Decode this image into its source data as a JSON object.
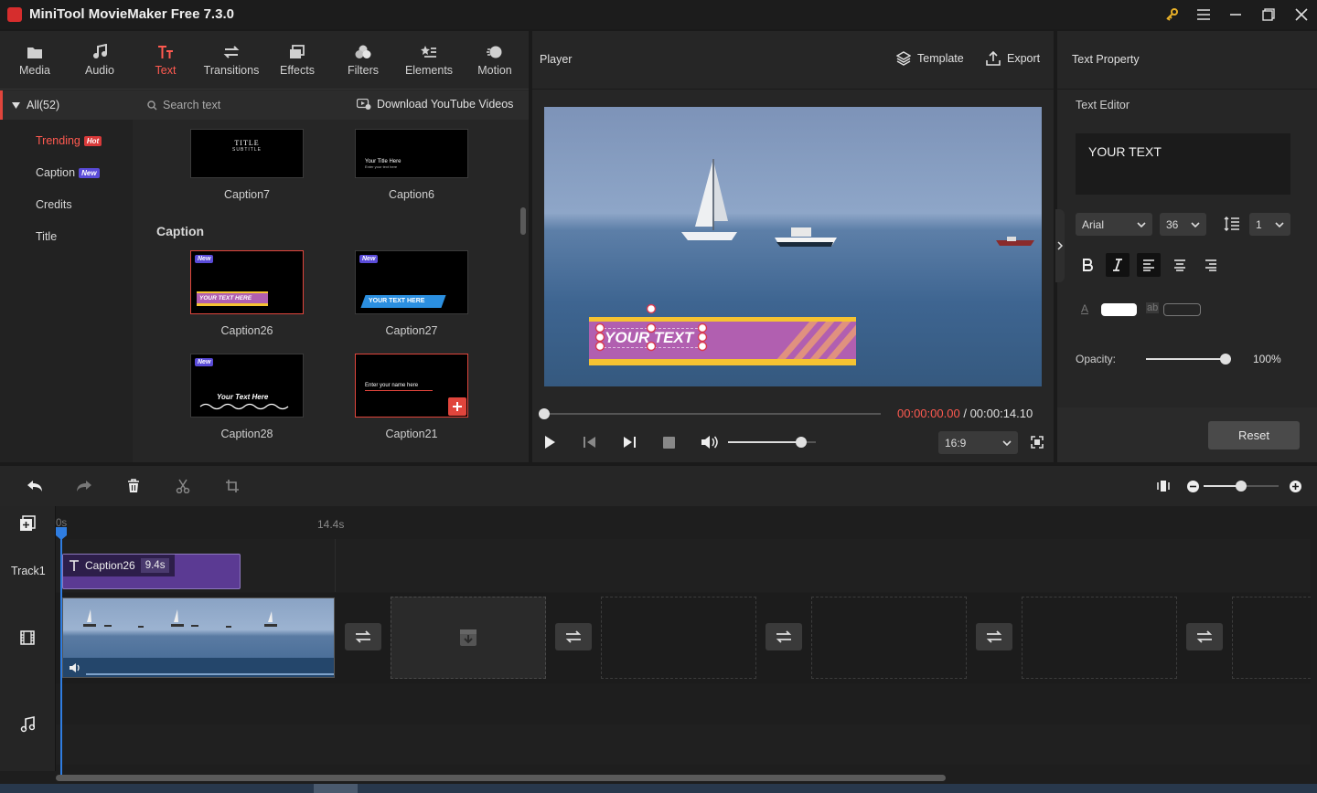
{
  "app": {
    "title": "MiniTool MovieMaker Free 7.3.0"
  },
  "media_tabs": [
    {
      "label": "Media",
      "icon": "folder-icon"
    },
    {
      "label": "Audio",
      "icon": "music-note-icon"
    },
    {
      "label": "Text",
      "icon": "text-icon",
      "active": true
    },
    {
      "label": "Transitions",
      "icon": "transitions-icon"
    },
    {
      "label": "Effects",
      "icon": "effects-icon"
    },
    {
      "label": "Filters",
      "icon": "filters-icon"
    },
    {
      "label": "Elements",
      "icon": "elements-icon"
    },
    {
      "label": "Motion",
      "icon": "motion-icon"
    }
  ],
  "categories": {
    "all_label": "All(52)",
    "items": [
      {
        "label": "Trending",
        "badge": "Hot",
        "active": true
      },
      {
        "label": "Caption",
        "badge": "New"
      },
      {
        "label": "Credits"
      },
      {
        "label": "Title"
      }
    ]
  },
  "library": {
    "search_placeholder": "Search text",
    "download_label": "Download YouTube Videos",
    "section_heading": "Caption",
    "top_items": [
      {
        "name": "Caption7",
        "thumb_line1": "TITLE",
        "thumb_line2": "SUBTITLE"
      },
      {
        "name": "Caption6",
        "thumb_line1": "Your  Title Here",
        "thumb_line2": "Enter your text here"
      }
    ],
    "items": [
      {
        "name": "Caption26",
        "thumb_text": "YOUR TEXT HERE",
        "new_tag": "New",
        "selected": true
      },
      {
        "name": "Caption27",
        "thumb_text": "YOUR TEXT HERE",
        "new_tag": "New"
      },
      {
        "name": "Caption28",
        "thumb_text": "Your Text Here",
        "new_tag": "New"
      },
      {
        "name": "Caption21",
        "thumb_text": "Enter your name here",
        "selected": true
      }
    ]
  },
  "player": {
    "title": "Player",
    "template_label": "Template",
    "export_label": "Export",
    "overlay_text": "YOUR TEXT",
    "current_time": "00:00:00.00",
    "separator": "/",
    "total_time": "00:00:14.10",
    "aspect_ratio": "16:9",
    "progress": 0.0,
    "volume": 0.83
  },
  "text_property": {
    "title": "Text Property",
    "editor_label": "Text Editor",
    "text_value": "YOUR TEXT",
    "font": "Arial",
    "size": "36",
    "line_spacing": "1",
    "font_color_letter": "A",
    "bg_color_letters": "ab",
    "opacity_label": "Opacity:",
    "opacity_value": "100%",
    "opacity": 1.0,
    "reset_label": "Reset"
  },
  "timeline": {
    "ruler_start": "0s",
    "ruler_mark": "14.4s",
    "track1_label": "Track1",
    "text_clip": {
      "name": "Caption26",
      "duration": "9.4s"
    },
    "zoom": 0.5
  },
  "colors": {
    "accent_red": "#ff5a50",
    "playhead_blue": "#2f7de1",
    "caption_purple": "#b15fb0",
    "caption_yellow": "#f5c332",
    "text_clip_purple": "#5b3a93"
  }
}
